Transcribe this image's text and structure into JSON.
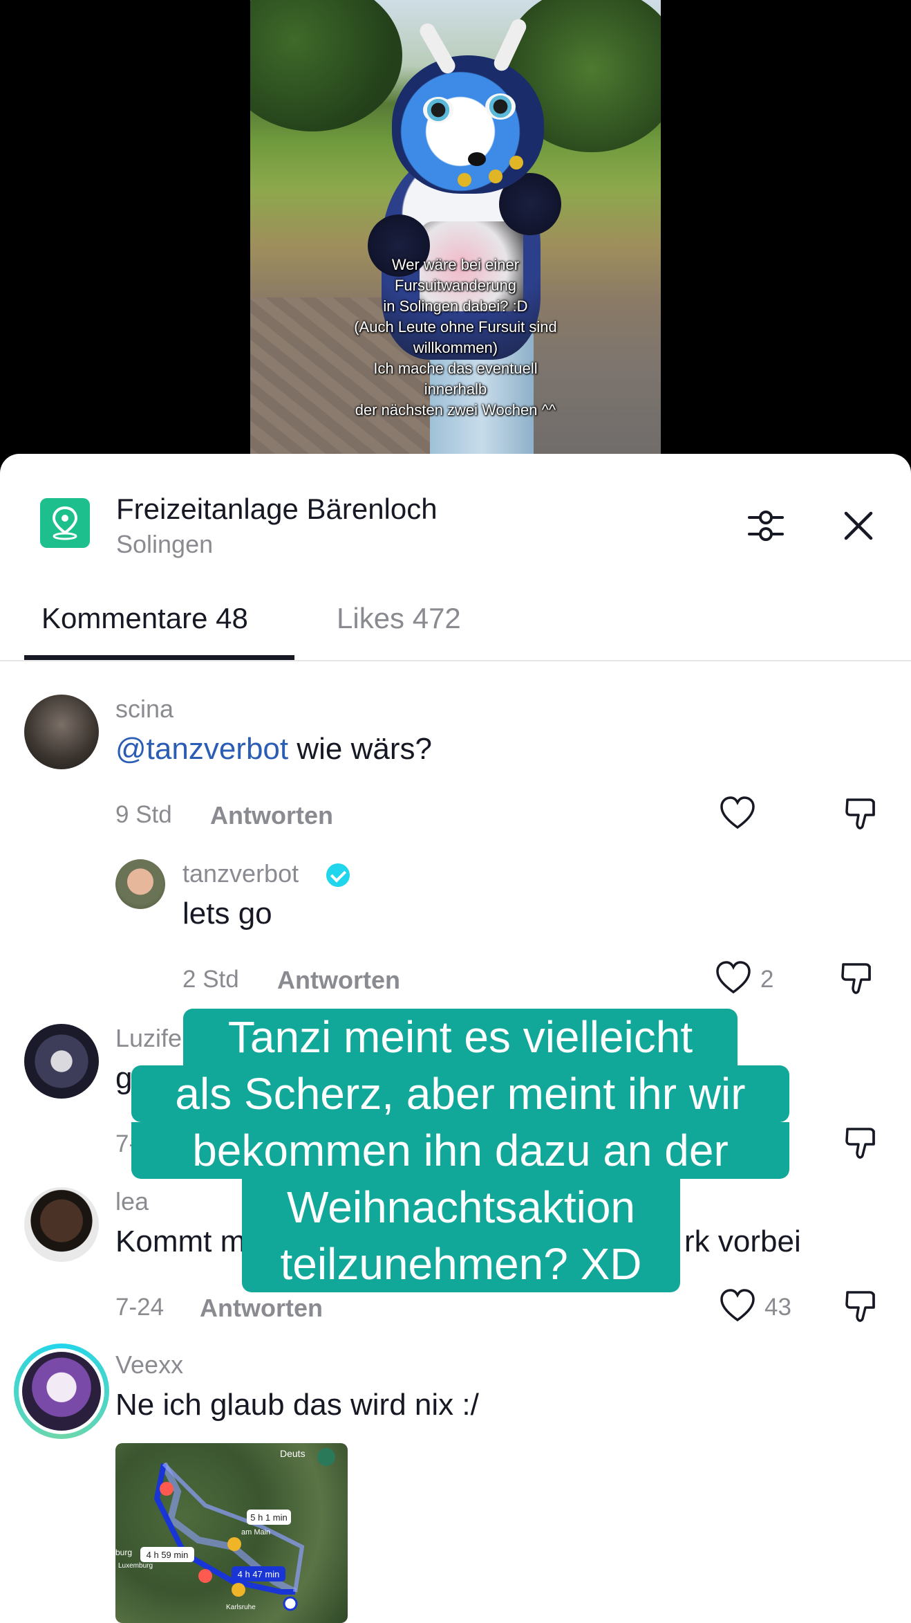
{
  "video": {
    "caption": "Wer wäre bei einer\nFursuitwanderung\nin Solingen dabei? :D\n(Auch Leute ohne Fursuit sind\nwillkommen)\nIch mache das eventuell\ninnerhalb\nder nächsten zwei Wochen ^^"
  },
  "location": {
    "title": "Freizeitanlage Bärenloch",
    "subtitle": "Solingen"
  },
  "tabs": {
    "comments": "Kommentare 48",
    "likes": "Likes 472"
  },
  "comments": [
    {
      "user": "scina",
      "mention": "@tanzverbot",
      "text": " wie wärs?",
      "time": "9 Std",
      "reply": "Antworten",
      "likes": ""
    },
    {
      "user": "tanzverbot",
      "text": "lets go",
      "time": "2 Std",
      "reply": "Antworten",
      "likes": "2"
    },
    {
      "user": "Luzife",
      "text": "g",
      "time": "7-",
      "reply": "",
      "likes": ""
    },
    {
      "user": "lea",
      "text_left": "Kommt m",
      "text_right": "rk vorbei",
      "time": "7-24",
      "reply": "Antworten",
      "likes": "43"
    },
    {
      "user": "Veexx",
      "text": "Ne ich glaub das wird nix :/",
      "map_labels": [
        "Deuts",
        "5 h 1 min",
        "am Main",
        "4 h 59 min",
        "4 h 47 min",
        "burg",
        "Luxemburg",
        "Karlsruhe"
      ]
    }
  ],
  "overlay": {
    "lines": [
      "Tanzi meint es vielleicht",
      "als Scherz, aber meint ihr wir",
      "bekommen ihn dazu an der",
      "Weihnachtsaktion",
      "teilzunehmen? XD"
    ],
    "color": "#11a89a"
  },
  "colors": {
    "mention": "#2b5db4",
    "location_badge": "#1dbf8d",
    "verified": "#20d5ec"
  }
}
